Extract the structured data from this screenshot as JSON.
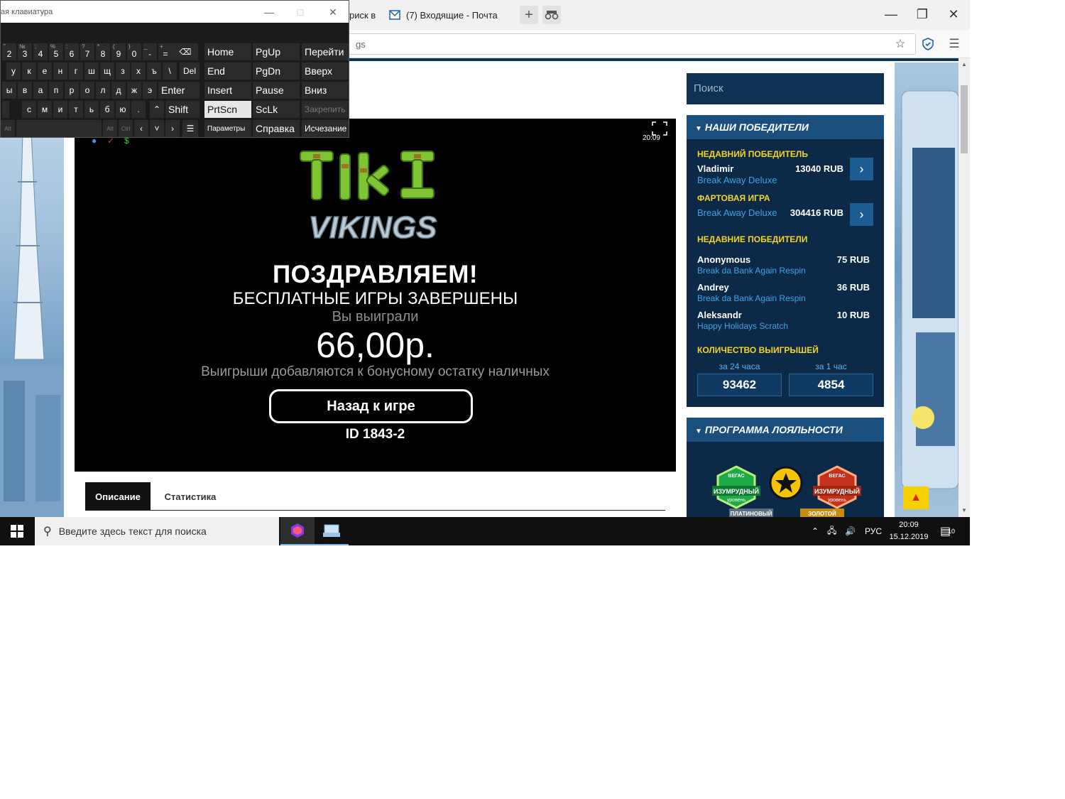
{
  "browser": {
    "tab1_label": "риск в",
    "tab2_label": "(7) Входящие - Почта",
    "url_tail": "gs"
  },
  "osk": {
    "title": "ая клавиатура",
    "row1": [
      "2",
      "3",
      "4",
      "5",
      "6",
      "7",
      "8",
      "9",
      "0",
      "-",
      "="
    ],
    "row1_shift": [
      "\"",
      "№",
      ";",
      "%",
      ":",
      "?",
      "*",
      "(",
      ")",
      "_",
      "+"
    ],
    "row2": [
      "у",
      "к",
      "е",
      "н",
      "г",
      "ш",
      "щ",
      "з",
      "х",
      "ъ",
      "\\"
    ],
    "row3": [
      "ы",
      "в",
      "а",
      "п",
      "р",
      "о",
      "л",
      "д",
      "ж",
      "э"
    ],
    "row4": [
      "с",
      "м",
      "и",
      "т",
      "ь",
      "б",
      "ю",
      "."
    ],
    "row4_shift": [
      ",",
      "/"
    ],
    "del": "Del",
    "enter": "Enter",
    "shift": "Shift",
    "alt": "Alt",
    "ctrl": "Ctrl",
    "nav": {
      "home": "Home",
      "pgup": "PgUp",
      "goto": "Перейти",
      "end": "End",
      "pgdn": "PgDn",
      "up": "Вверх",
      "insert": "Insert",
      "pause": "Pause",
      "down": "Вниз",
      "prtscn": "PrtScn",
      "sclk": "ScLk",
      "dock": "Закрепить",
      "options": "Параметры",
      "help": "Справка",
      "fade": "Исчезание"
    }
  },
  "game": {
    "time": "20:09",
    "congrats": "ПОЗДРАВЛЯЕМ!",
    "free_games_done": "БЕСПЛАТНЫЕ ИГРЫ ЗАВЕРШЕНЫ",
    "you_won": "Вы выиграли",
    "amount": "66,00р.",
    "note": "Выигрыши добавляются к бонусному остатку наличных",
    "back_button": "Назад к игре",
    "id": "ID 1843-2",
    "logo_top": "TIKI",
    "logo_bottom": "VIKINGS"
  },
  "page_tabs": {
    "description": "Описание",
    "stats": "Статистика"
  },
  "sidebar": {
    "search_placeholder": "Поиск",
    "winners_title": "НАШИ ПОБЕДИТЕЛИ",
    "recent_winner_label": "НЕДАВНИЙ ПОБЕДИТЕЛЬ",
    "recent_winner": {
      "name": "Vladimir",
      "amount": "13040 RUB",
      "game": "Break Away Deluxe"
    },
    "lucky_game_label": "ФАРТОВАЯ ИГРА",
    "lucky_game": {
      "game": "Break Away Deluxe",
      "amount": "304416 RUB"
    },
    "recent_winners_label": "НЕДАВНИЕ ПОБЕДИТЕЛИ",
    "recent_winners": [
      {
        "name": "Anonymous",
        "amount": "75 RUB",
        "game": "Break da Bank Again Respin"
      },
      {
        "name": "Andrey",
        "amount": "36 RUB",
        "game": "Break da Bank Again Respin"
      },
      {
        "name": "Aleksandr",
        "amount": "10 RUB",
        "game": "Happy Holidays Scratch"
      }
    ],
    "wins_count_label": "КОЛИЧЕСТВО ВЫИГРЫШЕЙ",
    "period_24h": "за 24 часа",
    "period_1h": "за 1 час",
    "count_24h": "93462",
    "count_1h": "4854",
    "loyalty_title": "ПРОГРАММА ЛОЯЛЬНОСТИ",
    "badge_left": "ИЗУМРУДНЫЙ",
    "badge_left_sub": "уровень",
    "badge_right": "ИЗУМРУДНЫЙ",
    "badge_right_sub": "уровень",
    "badge_brand": "ВЕГАС",
    "badge_lower_left": "ПЛАТИНОВЫЙ",
    "badge_lower_right": "ЗОЛОТОЙ"
  },
  "taskbar": {
    "search_placeholder": "Введите здесь текст для поиска",
    "lang": "РУС",
    "time": "20:09",
    "date": "15.12.2019",
    "notifications": "10"
  }
}
